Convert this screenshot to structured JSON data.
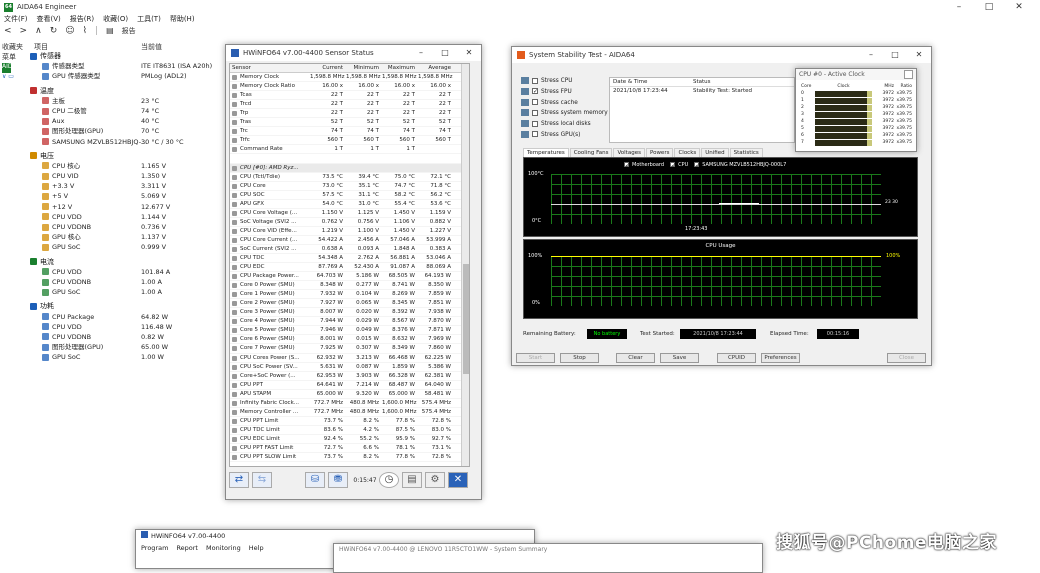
{
  "aida": {
    "title": "AIDA64 Engineer",
    "logo": "64",
    "menu": [
      "文件(F)",
      "查看(V)",
      "报告(R)",
      "收藏(O)",
      "工具(T)",
      "帮助(H)"
    ],
    "toolbar_report": "报告",
    "col_item": "项目",
    "col_value": "当前值",
    "left_header": [
      "收藏夹",
      "菜单"
    ],
    "left_items": [
      "AID",
      "@"
    ],
    "sections": [
      {
        "title": "传感器",
        "rows": [
          [
            "传感器类型",
            "ITE IT8631 (ISA A20h)"
          ],
          [
            "GPU 传感器类型",
            "PMLog (ADL2)"
          ]
        ]
      },
      {
        "title": "温度",
        "rows": [
          [
            "主板",
            "23 °C"
          ],
          [
            "CPU 二极管",
            "74 °C"
          ],
          [
            "Aux",
            "40 °C"
          ],
          [
            "图形处理器(GPU)",
            "70 °C"
          ],
          [
            "SAMSUNG MZVLB512HBJQ-...",
            "30 °C / 30 °C"
          ]
        ]
      },
      {
        "title": "电压",
        "rows": [
          [
            "CPU 核心",
            "1.165 V"
          ],
          [
            "CPU VID",
            "1.350 V"
          ],
          [
            "+3.3 V",
            "3.311 V"
          ],
          [
            "+5 V",
            "5.069 V"
          ],
          [
            "+12 V",
            "12.677 V"
          ],
          [
            "CPU VDD",
            "1.144 V"
          ],
          [
            "CPU VDDNB",
            "0.736 V"
          ],
          [
            "GPU 核心",
            "1.137 V"
          ],
          [
            "GPU SoC",
            "0.999 V"
          ]
        ]
      },
      {
        "title": "电流",
        "rows": [
          [
            "CPU VDD",
            "101.84 A"
          ],
          [
            "CPU VDDNB",
            "1.00 A"
          ],
          [
            "GPU SoC",
            "1.00 A"
          ]
        ]
      },
      {
        "title": "功耗",
        "rows": [
          [
            "CPU Package",
            "64.82 W"
          ],
          [
            "CPU VDD",
            "116.48 W"
          ],
          [
            "CPU VDDNB",
            "0.82 W"
          ],
          [
            "图形处理器(GPU)",
            "65.00 W"
          ],
          [
            "GPU SoC",
            "1.00 W"
          ]
        ]
      }
    ]
  },
  "hwinfo": {
    "title": "HWiNFO64 v7.00-4400 Sensor Status",
    "headers": [
      "Sensor",
      "Current",
      "Minimum",
      "Maximum",
      "Average"
    ],
    "rows": [
      [
        "Memory Clock",
        "1,598.8 MHz",
        "1,598.8 MHz",
        "1,598.8 MHz",
        "1,598.8 MHz"
      ],
      [
        "Memory Clock Ratio",
        "16.00 x",
        "16.00 x",
        "16.00 x",
        "16.00 x"
      ],
      [
        "Tcas",
        "22 T",
        "22 T",
        "22 T",
        "22 T"
      ],
      [
        "Trcd",
        "22 T",
        "22 T",
        "22 T",
        "22 T"
      ],
      [
        "Trp",
        "22 T",
        "22 T",
        "22 T",
        "22 T"
      ],
      [
        "Tras",
        "52 T",
        "52 T",
        "52 T",
        "52 T"
      ],
      [
        "Trc",
        "74 T",
        "74 T",
        "74 T",
        "74 T"
      ],
      [
        "Trfc",
        "560 T",
        "560 T",
        "560 T",
        "560 T"
      ],
      [
        "Command Rate",
        "1 T",
        "1 T",
        "1 T",
        ""
      ],
      [
        "",
        "",
        "",
        "",
        ""
      ],
      [
        "CPU [#0]: AMD Ryz...",
        "",
        "",
        "",
        ""
      ],
      [
        "CPU (Tctl/Tdie)",
        "73.5 °C",
        "39.4 °C",
        "75.0 °C",
        "72.1 °C"
      ],
      [
        "CPU Core",
        "73.0 °C",
        "35.1 °C",
        "74.7 °C",
        "71.8 °C"
      ],
      [
        "CPU SOC",
        "57.5 °C",
        "31.1 °C",
        "58.2 °C",
        "56.2 °C"
      ],
      [
        "APU GFX",
        "54.0 °C",
        "31.0 °C",
        "55.4 °C",
        "53.6 °C"
      ],
      [
        "CPU Core Voltage (...",
        "1.150 V",
        "1.125 V",
        "1.450 V",
        "1.159 V"
      ],
      [
        "SoC Voltage (SVI2 ...",
        "0.762 V",
        "0.756 V",
        "1.106 V",
        "0.882 V"
      ],
      [
        "CPU Core VID (Effe...",
        "1.219 V",
        "1.100 V",
        "1.450 V",
        "1.227 V"
      ],
      [
        "CPU Core Current (...",
        "54.422 A",
        "2.456 A",
        "57.046 A",
        "53.999 A"
      ],
      [
        "SoC Current (SVI2 ...",
        "0.638 A",
        "0.093 A",
        "1.848 A",
        "0.383 A"
      ],
      [
        "CPU TDC",
        "54.348 A",
        "2.762 A",
        "56.881 A",
        "53.046 A"
      ],
      [
        "CPU EDC",
        "87.769 A",
        "52.430 A",
        "91.087 A",
        "88.069 A"
      ],
      [
        "CPU Package Power...",
        "64.703 W",
        "5.186 W",
        "68.505 W",
        "64.193 W"
      ],
      [
        "Core 0 Power (SMU)",
        "8.348 W",
        "0.277 W",
        "8.741 W",
        "8.350 W"
      ],
      [
        "Core 1 Power (SMU)",
        "7.932 W",
        "0.104 W",
        "8.269 W",
        "7.859 W"
      ],
      [
        "Core 2 Power (SMU)",
        "7.927 W",
        "0.065 W",
        "8.345 W",
        "7.851 W"
      ],
      [
        "Core 3 Power (SMU)",
        "8.007 W",
        "0.020 W",
        "8.392 W",
        "7.938 W"
      ],
      [
        "Core 4 Power (SMU)",
        "7.944 W",
        "0.029 W",
        "8.567 W",
        "7.870 W"
      ],
      [
        "Core 5 Power (SMU)",
        "7.946 W",
        "0.049 W",
        "8.376 W",
        "7.871 W"
      ],
      [
        "Core 6 Power (SMU)",
        "8.001 W",
        "0.015 W",
        "8.632 W",
        "7.969 W"
      ],
      [
        "Core 7 Power (SMU)",
        "7.925 W",
        "0.307 W",
        "8.349 W",
        "7.860 W"
      ],
      [
        "CPU Cores Power (S...",
        "62.932 W",
        "3.213 W",
        "66.468 W",
        "62.225 W"
      ],
      [
        "CPU SoC Power (SV...",
        "5.631 W",
        "0.087 W",
        "1.859 W",
        "5.386 W"
      ],
      [
        "Core+SoC Power (...",
        "62.953 W",
        "3.903 W",
        "66.328 W",
        "62.381 W"
      ],
      [
        "CPU PPT",
        "64.641 W",
        "7.214 W",
        "68.487 W",
        "64.040 W"
      ],
      [
        "APU STAPM",
        "65.000 W",
        "9.320 W",
        "65.000 W",
        "58.481 W"
      ],
      [
        "Infinity Fabric Clock...",
        "772.7 MHz",
        "480.8 MHz",
        "1,600.0 MHz",
        "575.4 MHz"
      ],
      [
        "Memory Controller ...",
        "772.7 MHz",
        "480.8 MHz",
        "1,600.0 MHz",
        "575.4 MHz"
      ],
      [
        "CPU PPT Limit",
        "73.7 %",
        "8.2 %",
        "77.8 %",
        "72.8 %"
      ],
      [
        "CPU TDC Limit",
        "83.6 %",
        "4.2 %",
        "87.5 %",
        "83.0 %"
      ],
      [
        "CPU EDC Limit",
        "92.4 %",
        "55.2 %",
        "95.9 %",
        "92.7 %"
      ],
      [
        "CPU PPT FAST Limit",
        "72.7 %",
        "6.6 %",
        "78.1 %",
        "73.1 %"
      ],
      [
        "CPU PPT SLOW Limit",
        "73.7 %",
        "8.2 %",
        "77.8 %",
        "72.8 %"
      ]
    ],
    "timer": "0:15:47"
  },
  "sst": {
    "title": "System Stability Test - AIDA64",
    "stress": [
      [
        "Stress CPU",
        false
      ],
      [
        "Stress FPU",
        true
      ],
      [
        "Stress cache",
        false
      ],
      [
        "Stress system memory",
        false
      ],
      [
        "Stress local disks",
        false
      ],
      [
        "Stress GPU(s)",
        false
      ]
    ],
    "log_headers": [
      "Date & Time",
      "Status"
    ],
    "log_row": [
      "2021/10/8 17:23:44",
      "Stability Test: Started"
    ],
    "tabs": [
      "Temperatures",
      "Cooling Fans",
      "Voltages",
      "Powers",
      "Clocks",
      "Unified",
      "Statistics"
    ],
    "legend": [
      "Motherboard",
      "CPU",
      "SAMSUNG MZVLB512HBJQ-000L7"
    ],
    "temp_top": "100°C",
    "temp_bottom": "0°C",
    "temp_time": "17:23:43",
    "temp_right": "23 30",
    "usage_title": "CPU Usage",
    "usage_top": "100%",
    "usage_bottom": "0%",
    "usage_right": "100%",
    "battery_label": "Remaining Battery:",
    "battery_value": "No battery",
    "started_label": "Test Started:",
    "started_value": "2021/10/8 17:23:44",
    "elapsed_label": "Elapsed Time:",
    "elapsed_value": "00:15:16",
    "buttons": [
      "Start",
      "Stop",
      "Clear",
      "Save",
      "CPUID",
      "Preferences",
      "Close"
    ]
  },
  "clock": {
    "title": "CPU #0 - Active Clock",
    "headers": [
      "Core",
      "Clock",
      "MHz",
      "Ratio"
    ],
    "rows": [
      [
        "0",
        "3972",
        "x39.75",
        0.92
      ],
      [
        "1",
        "3972",
        "x39.75",
        0.92
      ],
      [
        "2",
        "3972",
        "x39.75",
        0.92
      ],
      [
        "3",
        "3972",
        "x39.75",
        0.92
      ],
      [
        "4",
        "3972",
        "x39.75",
        0.92
      ],
      [
        "5",
        "3972",
        "x39.75",
        0.92
      ],
      [
        "6",
        "3972",
        "x39.75",
        0.92
      ],
      [
        "7",
        "3972",
        "x39.75",
        0.92
      ]
    ]
  },
  "hwsum": {
    "title": "HWiNFO64 v7.00-4400",
    "menu": [
      "Program",
      "Report",
      "Monitoring",
      "Help"
    ]
  },
  "hwsys": {
    "title": "HWiNFO64 v7.00-4400 @ LENOVO 11R5CTO1WW - System Summary"
  },
  "watermark": "搜狐号@PChome电脑之家"
}
